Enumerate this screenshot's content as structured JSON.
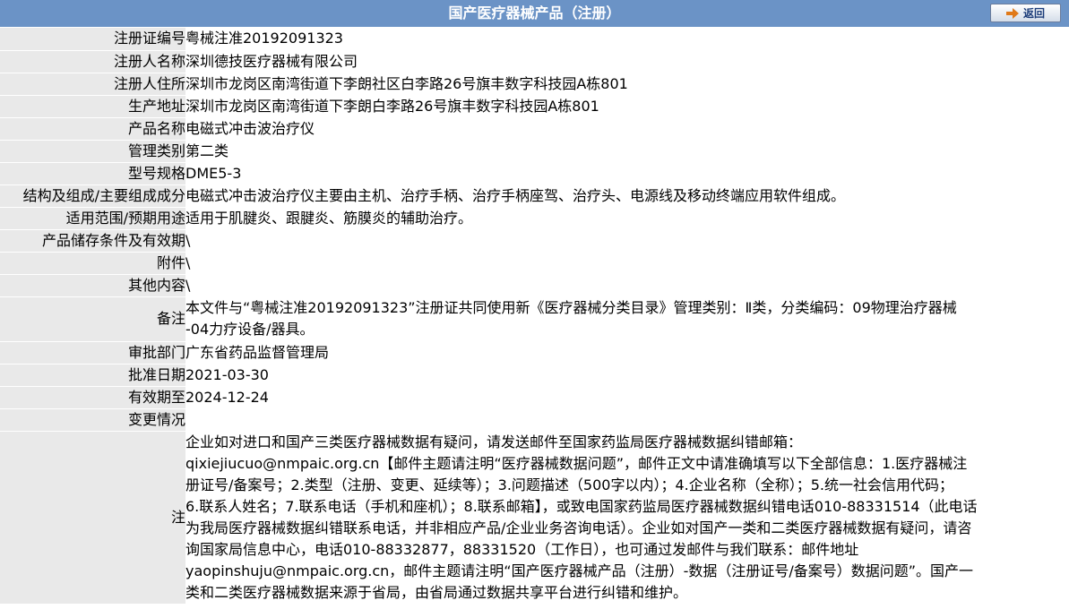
{
  "header": {
    "title": "国产医疗器械产品（注册）",
    "back_label": "返回"
  },
  "record": {
    "reg_no": {
      "label": "注册证编号",
      "value": "粤械注准20192091323"
    },
    "registrant_name": {
      "label": "注册人名称",
      "value": "深圳德技医疗器械有限公司"
    },
    "registrant_address": {
      "label": "注册人住所",
      "value": "深圳市龙岗区南湾街道下李朗社区白李路26号旗丰数字科技园A栋801"
    },
    "production_address": {
      "label": "生产地址",
      "value": "深圳市龙岗区南湾街道下李朗白李路26号旗丰数字科技园A栋801"
    },
    "product_name": {
      "label": "产品名称",
      "value": "电磁式冲击波治疗仪"
    },
    "management_class": {
      "label": "管理类别",
      "value": "第二类"
    },
    "model_spec": {
      "label": "型号规格",
      "value": "DME5-3"
    },
    "structure": {
      "label": "结构及组成/主要组成成分",
      "value": "电磁式冲击波治疗仪主要由主机、治疗手柄、治疗手柄座驾、治疗头、电源线及移动终端应用软件组成。"
    },
    "intended_use": {
      "label": "适用范围/预期用途",
      "value": "适用于肌腱炎、跟腱炎、筋膜炎的辅助治疗。"
    },
    "storage": {
      "label": "产品储存条件及有效期",
      "value": "\\"
    },
    "attachment": {
      "label": "附件",
      "value": "\\"
    },
    "other": {
      "label": "其他内容",
      "value": "\\"
    },
    "remarks": {
      "label": "备注",
      "value": "本文件与“粤械注准20192091323”注册证共同使用新《医疗器械分类目录》管理类别：Ⅱ类，分类编码：09物理治疗器械\n-04力疗设备/器具。"
    },
    "approval_dept": {
      "label": "审批部门",
      "value": "广东省药品监督管理局"
    },
    "approval_date": {
      "label": "批准日期",
      "value": "2021-03-30"
    },
    "valid_until": {
      "label": "有效期至",
      "value": "2024-12-24"
    },
    "changes": {
      "label": "变更情况",
      "value": ""
    },
    "notice": {
      "label": "注",
      "value": "企业如对进口和国产三类医疗器械数据有疑问，请发送邮件至国家药监局医疗器械数据纠错邮箱：\nqixiejiucuo@nmpaic.org.cn【邮件主题请注明“医疗器械数据问题”，邮件正文中请准确填写以下全部信息：1.医疗器械注\n册证号/备案号；2.类型（注册、变更、延续等）；3.问题描述（500字以内）；4.企业名称（全称）；5.统一社会信用代码；\n6.联系人姓名；7.联系电话（手机和座机）；8.联系邮箱】，或致电国家药监局医疗器械数据纠错电话010-88331514（此电话\n为我局医疗器械数据纠错联系电话，并非相应产品/企业业务咨询电话）。企业如对国产一类和二类医疗器械数据有疑问，请咨\n询国家局信息中心，电话010-88332877，88331520（工作日），也可通过发邮件与我们联系：邮件地址\nyaopinshuju@nmpaic.org.cn，邮件主题请注明“国产医疗器械产品（注册）-数据（注册证号/备案号）数据问题”。国产一\n类和二类医疗器械数据来源于省局，由省局通过数据共享平台进行纠错和维护。"
    }
  },
  "colors": {
    "header_bg": "#6b93c6",
    "label_bg": "#e9e9e9",
    "button_text": "#1c3d7a",
    "arrow": "#e07a1a"
  },
  "icons": {
    "back": "arrow-right-icon"
  }
}
